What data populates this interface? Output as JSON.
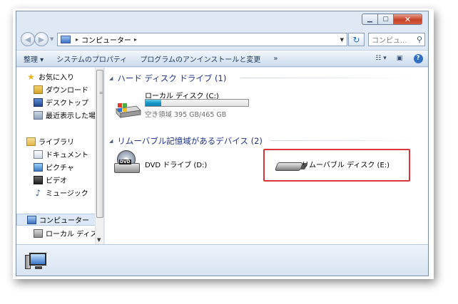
{
  "window": {
    "title_buttons": {
      "minimize": "▁",
      "maximize": "▢",
      "close": "✕"
    }
  },
  "address": {
    "path_item": "コンピューター",
    "search_placeholder": "コンピュ..."
  },
  "toolbar": {
    "organize": "整理 ▾",
    "system_properties": "システムのプロパティ",
    "uninstall": "プログラムのアンインストールと変更",
    "more": "»"
  },
  "nav": {
    "favorites": "お気に入り",
    "downloads": "ダウンロード",
    "desktop": "デスクトップ",
    "recent": "最近表示した場所",
    "libraries": "ライブラリ",
    "documents": "ドキュメント",
    "pictures": "ピクチャ",
    "videos": "ビデオ",
    "music": "ミュージック",
    "computer": "コンピューター",
    "local_disk": "ローカル ディスク"
  },
  "content": {
    "group_hdd": "ハード ディスク ドライブ (1)",
    "local_disk_name": "ローカル ディスク (C:)",
    "local_disk_free": "空き領域 395 GB/465 GB",
    "local_disk_used_fraction": 0.15,
    "group_removable": "リムーバブル記憶域があるデバイス (2)",
    "dvd_name": "DVD ドライブ (D:)",
    "dvd_badge": "DVD",
    "removable_name": "リムーバブル ディスク (E:)"
  },
  "colors": {
    "highlight_border": "#d9363e",
    "usage_bar": "#1a98c7",
    "group_header": "#1e3287"
  }
}
